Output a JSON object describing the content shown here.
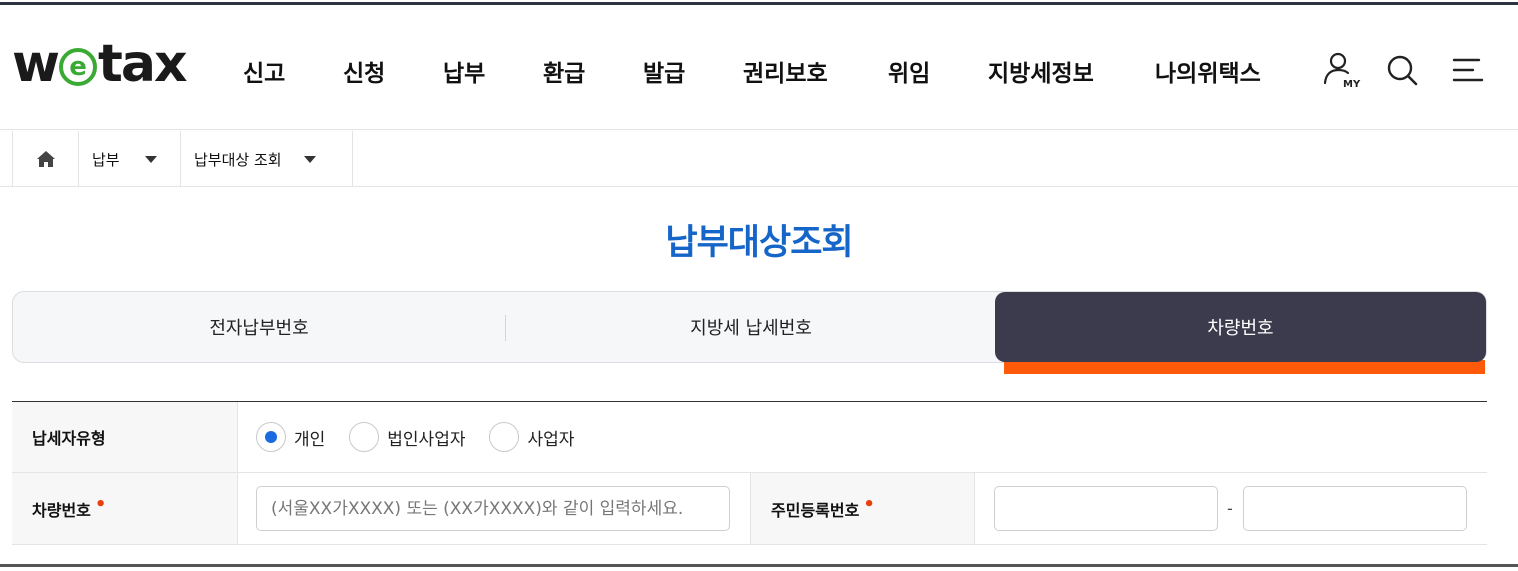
{
  "header": {
    "logo": {
      "part1": "w",
      "part2": "e",
      "part3": "tax"
    },
    "nav": [
      "신고",
      "신청",
      "납부",
      "환급",
      "발급",
      "권리보호",
      "위임",
      "지방세정보",
      "나의위택스"
    ],
    "my_icon_text": "MY"
  },
  "icons": {
    "home": "home-icon",
    "my": "user-my-icon",
    "search": "search-icon",
    "menu": "menu-icon",
    "caret": "caret-down-icon"
  },
  "breadcrumb": {
    "level1": "납부",
    "level2": "납부대상 조회"
  },
  "page": {
    "title": "납부대상조회"
  },
  "tabs": [
    {
      "label": "전자납부번호",
      "active": false
    },
    {
      "label": "지방세 납세번호",
      "active": false
    },
    {
      "label": "차량번호",
      "active": true
    }
  ],
  "form": {
    "taxpayer_type": {
      "label": "납세자유형",
      "options": [
        {
          "label": "개인",
          "checked": true
        },
        {
          "label": "법인사업자",
          "checked": false
        },
        {
          "label": "사업자",
          "checked": false
        }
      ]
    },
    "vehicle": {
      "label": "차량번호",
      "required_mark": "•",
      "placeholder": "(서울XX가XXXX) 또는 (XX가XXXX)와 같이 입력하세요.",
      "value": ""
    },
    "resident_no": {
      "label": "주민등록번호",
      "required_mark": "•",
      "separator": "-",
      "part1": "",
      "part2": ""
    }
  },
  "colors": {
    "title_blue": "#1665c8",
    "active_tab": "#3b3b4d",
    "accent_orange": "#ff5a0a",
    "logo_green": "#3aaa35",
    "radio_blue": "#1a6be0"
  }
}
